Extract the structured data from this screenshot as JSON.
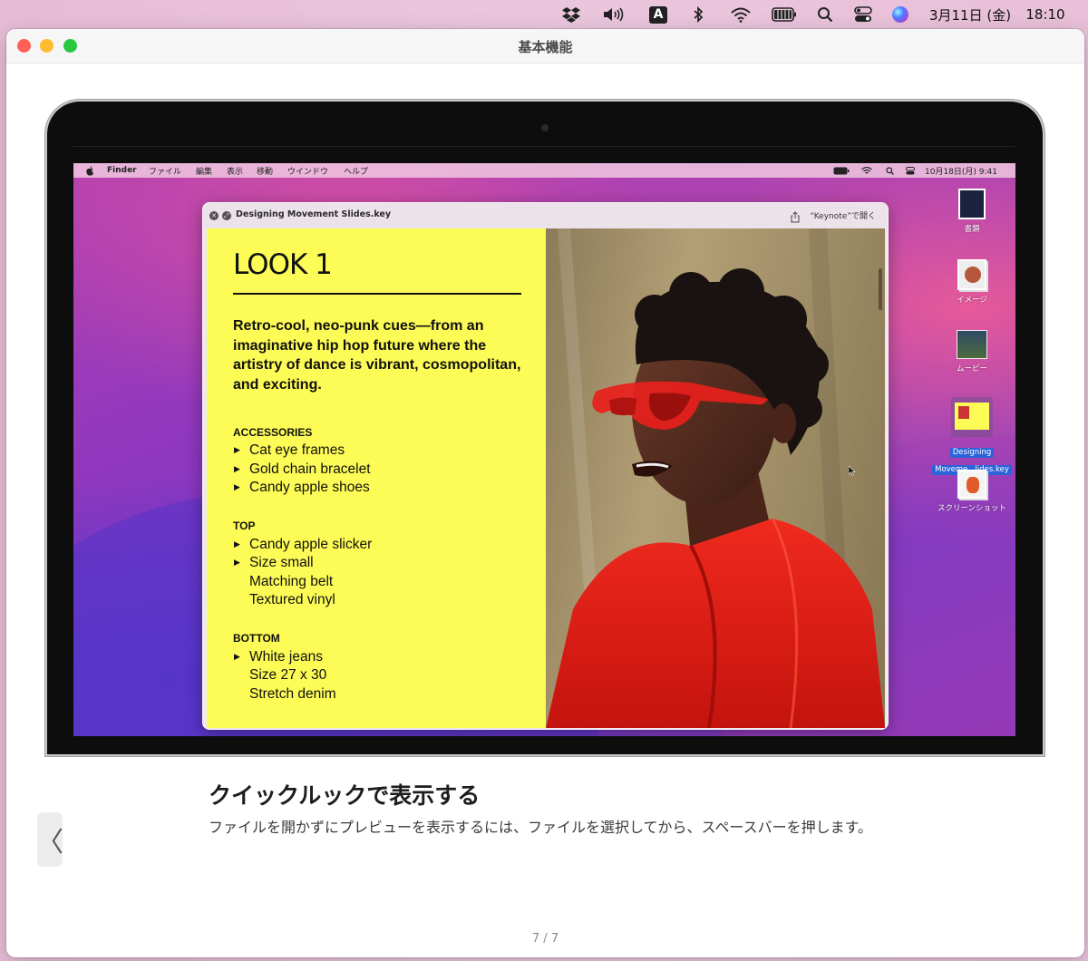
{
  "menubar": {
    "date": "3月11日 (金)",
    "time": "18:10",
    "input_badge": "A",
    "icons": [
      "dropbox-icon",
      "volume-icon",
      "input-source-icon",
      "bluetooth-icon",
      "wifi-icon",
      "battery-icon",
      "search-icon",
      "control-center-icon",
      "siri-icon"
    ]
  },
  "window": {
    "title": "基本機能"
  },
  "inner": {
    "menubar": {
      "app": "Finder",
      "items": [
        "ファイル",
        "編集",
        "表示",
        "移動",
        "ウインドウ",
        "ヘルプ"
      ],
      "datetime": "10月18日(月) 9:41"
    },
    "quicklook": {
      "title": "Designing Movement Slides.key",
      "open_button": "“Keynote”で開く",
      "slide": {
        "heading": "LOOK 1",
        "intro": "Retro-cool, neo-punk cues—from an imaginative hip hop future where the artistry of dance is vibrant, cosmopolitan, and exciting.",
        "sections": [
          {
            "title": "ACCESSORIES",
            "items": [
              "Cat eye frames",
              "Gold chain bracelet",
              "Candy apple shoes"
            ]
          },
          {
            "title": "TOP",
            "items": [
              "Candy apple slicker",
              "Size small",
              "Matching belt",
              "Textured vinyl"
            ]
          },
          {
            "title": "BOTTOM",
            "items": [
              "White jeans",
              "Size 27 x 30",
              "Stretch denim"
            ]
          }
        ]
      }
    },
    "desktop_icons": [
      {
        "label": "書類"
      },
      {
        "label": "イメージ"
      },
      {
        "label": "ムービー"
      },
      {
        "label": "Designing",
        "label2": "Moveme...lides.key"
      },
      {
        "label": "スクリーンショット"
      }
    ]
  },
  "content": {
    "heading": "クイックルックで表示する",
    "description": "ファイルを開かずにプレビューを表示するには、ファイルを選択してから、スペースバーを押します。",
    "back_label": "〈",
    "pager": "7 / 7"
  },
  "colors": {
    "slide_yellow": "#fdfb55",
    "selection_blue": "#2b63d9",
    "traffic_red": "#ff5f57",
    "traffic_yellow": "#febc2e",
    "traffic_green": "#28c840"
  }
}
